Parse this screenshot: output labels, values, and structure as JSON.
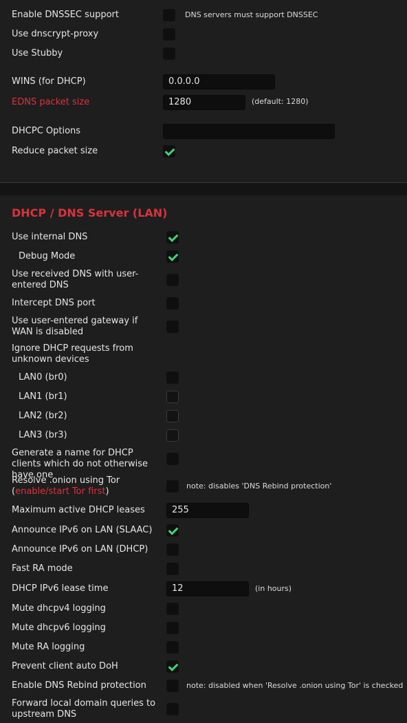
{
  "top": {
    "dnssec": {
      "label": "Enable DNSSEC support",
      "note": "DNS servers must support DNSSEC"
    },
    "dnscrypt": {
      "label": "Use dnscrypt-proxy"
    },
    "stubby": {
      "label": "Use Stubby"
    },
    "wins": {
      "label": "WINS (for DHCP)",
      "value": "0.0.0.0"
    },
    "edns": {
      "label": "EDNS packet size",
      "value": "1280",
      "note": "(default: 1280)"
    },
    "dhcpc": {
      "label": "DHCPC Options",
      "value": ""
    },
    "reduce": {
      "label": "Reduce packet size"
    }
  },
  "lan": {
    "title": "DHCP / DNS Server (LAN)",
    "internal_dns": "Use internal DNS",
    "debug_mode": "Debug Mode",
    "received_dns": "Use received DNS with user-entered DNS",
    "intercept_dns": "Intercept DNS port",
    "user_gateway": "Use user-entered gateway if WAN is disabled",
    "ignore_dhcp": "Ignore DHCP requests from unknown devices",
    "lan0": "LAN0 (br0)",
    "lan1": "LAN1 (br1)",
    "lan2": "LAN2 (br2)",
    "lan3": "LAN3 (br3)",
    "generate_name": "Generate a name for DHCP clients which do not otherwise have one",
    "resolve_onion": "Resolve .onion using Tor",
    "tor_link": "enable/start Tor first",
    "resolve_onion_note": "note: disables 'DNS Rebind protection'",
    "max_leases": {
      "label": "Maximum active DHCP leases",
      "value": "255"
    },
    "ipv6_slaac": "Announce IPv6 on LAN (SLAAC)",
    "ipv6_dhcp": "Announce IPv6 on LAN (DHCP)",
    "fast_ra": "Fast RA mode",
    "ipv6_lease": {
      "label": "DHCP IPv6 lease time",
      "value": "12",
      "note": "(in hours)"
    },
    "mute_v4": "Mute dhcpv4 logging",
    "mute_v6": "Mute dhcpv6 logging",
    "mute_ra": "Mute RA logging",
    "prevent_doh": "Prevent client auto DoH",
    "rebind": "Enable DNS Rebind protection",
    "rebind_note": "note: disabled when 'Resolve .onion using Tor' is checked",
    "forward_local": "Forward local domain queries to upstream DNS"
  },
  "colors": {
    "accent": "#d9333d",
    "check": "#3fd37a",
    "background": "#1e1e1e"
  }
}
